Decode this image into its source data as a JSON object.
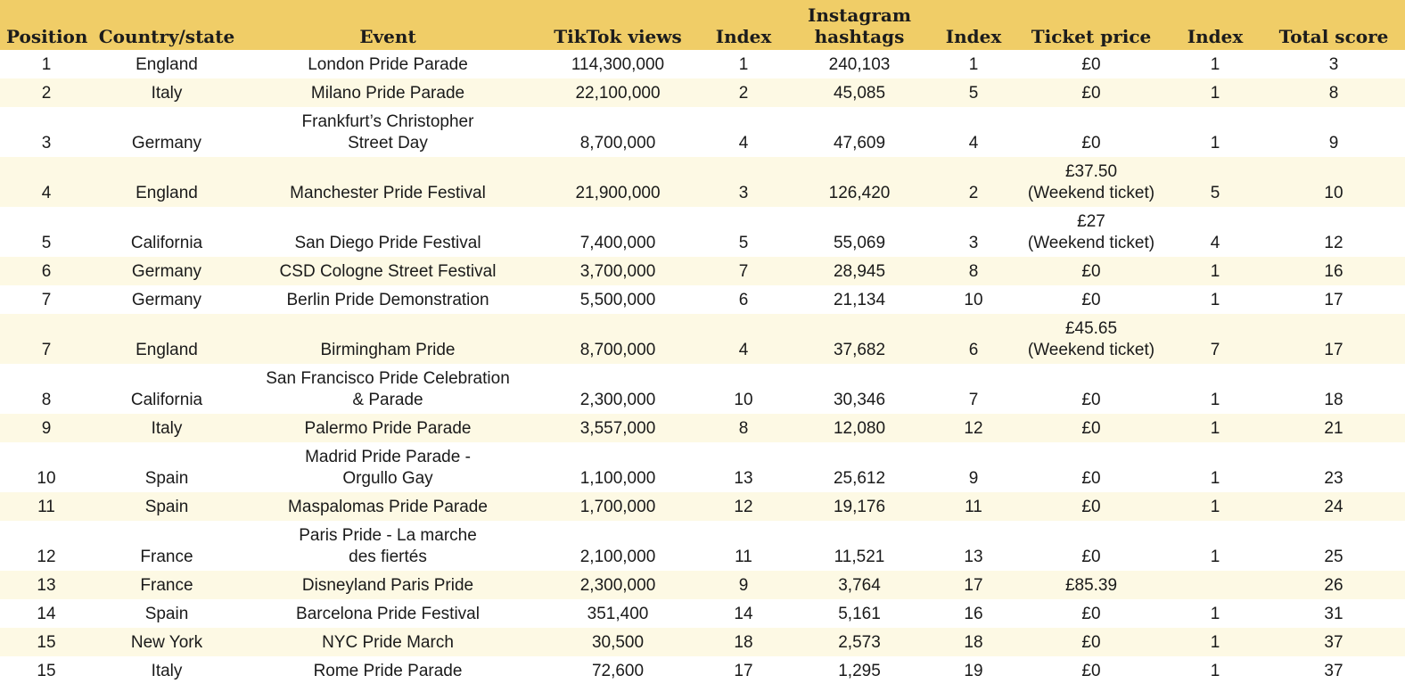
{
  "table": {
    "headers": [
      {
        "key": "position",
        "label": "Position"
      },
      {
        "key": "country",
        "label": "Country/state"
      },
      {
        "key": "event",
        "label": "Event"
      },
      {
        "key": "tiktok",
        "label": "TikTok views"
      },
      {
        "key": "index1",
        "label": "Index"
      },
      {
        "key": "instagram",
        "label": "Instagram\nhashtags"
      },
      {
        "key": "index2",
        "label": "Index"
      },
      {
        "key": "ticket",
        "label": "Ticket price"
      },
      {
        "key": "index3",
        "label": "Index"
      },
      {
        "key": "total",
        "label": "Total score"
      }
    ],
    "rows": [
      [
        "1",
        "England",
        "London Pride Parade",
        "114,300,000",
        "1",
        "240,103",
        "1",
        "£0",
        "1",
        "3"
      ],
      [
        "2",
        "Italy",
        "Milano Pride Parade",
        "22,100,000",
        "2",
        "45,085",
        "5",
        "£0",
        "1",
        "8"
      ],
      [
        "3",
        "Germany",
        "Frankfurt’s Christopher\nStreet Day",
        "8,700,000",
        "4",
        "47,609",
        "4",
        "£0",
        "1",
        "9"
      ],
      [
        "4",
        "England",
        "Manchester Pride Festival",
        "21,900,000",
        "3",
        "126,420",
        "2",
        "£37.50\n(Weekend ticket)",
        "5",
        "10"
      ],
      [
        "5",
        "California",
        "San Diego Pride Festival",
        "7,400,000",
        "5",
        "55,069",
        "3",
        "£27\n(Weekend ticket)",
        "4",
        "12"
      ],
      [
        "6",
        "Germany",
        "CSD Cologne Street Festival",
        "3,700,000",
        "7",
        "28,945",
        "8",
        "£0",
        "1",
        "16"
      ],
      [
        "7",
        "Germany",
        "Berlin Pride Demonstration",
        "5,500,000",
        "6",
        "21,134",
        "10",
        "£0",
        "1",
        "17"
      ],
      [
        "7",
        "England",
        "Birmingham Pride",
        "8,700,000",
        "4",
        "37,682",
        "6",
        "£45.65\n(Weekend ticket)",
        "7",
        "17"
      ],
      [
        "8",
        "California",
        "San Francisco Pride Celebration\n& Parade",
        "2,300,000",
        "10",
        "30,346",
        "7",
        "£0",
        "1",
        "18"
      ],
      [
        "9",
        "Italy",
        "Palermo Pride Parade",
        "3,557,000",
        "8",
        "12,080",
        "12",
        "£0",
        "1",
        "21"
      ],
      [
        "10",
        "Spain",
        "Madrid Pride Parade -\nOrgullo Gay",
        "1,100,000",
        "13",
        "25,612",
        "9",
        "£0",
        "1",
        "23"
      ],
      [
        "11",
        "Spain",
        "Maspalomas Pride Parade",
        "1,700,000",
        "12",
        "19,176",
        "11",
        "£0",
        "1",
        "24"
      ],
      [
        "12",
        "France",
        "Paris Pride - La marche\ndes fiertés",
        "2,100,000",
        "11",
        "11,521",
        "13",
        "£0",
        "1",
        "25"
      ],
      [
        "13",
        "France",
        "Disneyland Paris Pride",
        "2,300,000",
        "9",
        "3,764",
        "17",
        "£85.39",
        "",
        "26"
      ],
      [
        "14",
        "Spain",
        "Barcelona Pride Festival",
        "351,400",
        "14",
        "5,161",
        "16",
        "£0",
        "1",
        "31"
      ],
      [
        "15",
        "New York",
        "NYC Pride March",
        "30,500",
        "18",
        "2,573",
        "18",
        "£0",
        "1",
        "37"
      ],
      [
        "15",
        "Italy",
        "Rome Pride Parade",
        "72,600",
        "17",
        "1,295",
        "19",
        "£0",
        "1",
        "37"
      ]
    ]
  },
  "colors": {
    "header_background": "#f0cd67",
    "row_stripe": "#fdf9e4",
    "row_plain": "#ffffff"
  }
}
